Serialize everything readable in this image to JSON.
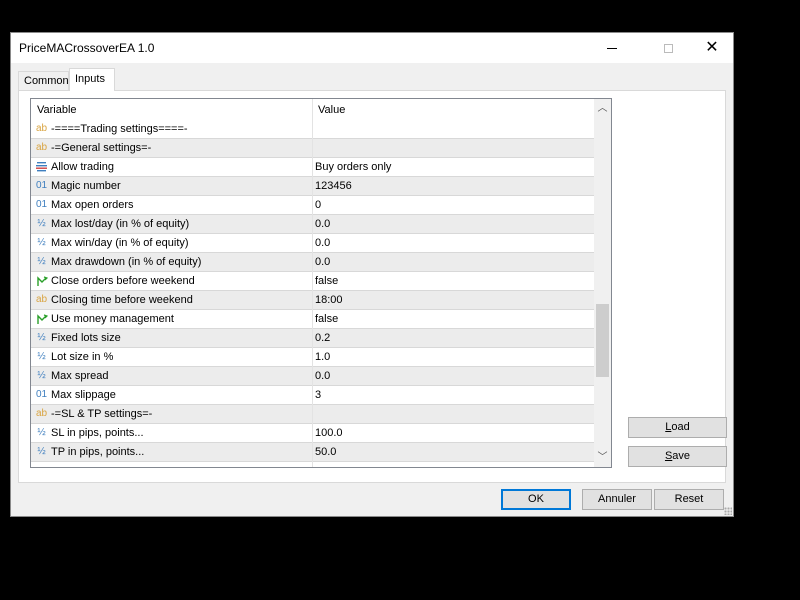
{
  "window": {
    "title": "PriceMACrossoverEA 1.0",
    "controls": {
      "minimize": "minimize-icon",
      "maximize": "maximize-icon",
      "close": "close-icon"
    }
  },
  "tabs": [
    {
      "label": "Common",
      "active": false
    },
    {
      "label": "Inputs",
      "active": true
    }
  ],
  "grid": {
    "columns": {
      "variable": "Variable",
      "value": "Value"
    },
    "rows": [
      {
        "icon": "string-icon",
        "name": "-====Trading settings====-",
        "value": ""
      },
      {
        "icon": "string-icon",
        "name": "-=General settings=-",
        "value": ""
      },
      {
        "icon": "enum-icon",
        "name": "Allow trading",
        "value": "Buy orders only"
      },
      {
        "icon": "integer-icon",
        "name": "Magic number",
        "value": "123456"
      },
      {
        "icon": "integer-icon",
        "name": "Max open orders",
        "value": "0"
      },
      {
        "icon": "double-icon",
        "name": "Max lost/day (in % of equity)",
        "value": "0.0"
      },
      {
        "icon": "double-icon",
        "name": "Max win/day (in % of equity)",
        "value": "0.0"
      },
      {
        "icon": "double-icon",
        "name": "Max drawdown (in % of equity)",
        "value": "0.0"
      },
      {
        "icon": "bool-icon",
        "name": "Close orders before weekend",
        "value": "false"
      },
      {
        "icon": "string-icon",
        "name": "Closing time before weekend",
        "value": "18:00"
      },
      {
        "icon": "bool-icon",
        "name": "Use money management",
        "value": "false"
      },
      {
        "icon": "double-icon",
        "name": "Fixed lots size",
        "value": "0.2"
      },
      {
        "icon": "double-icon",
        "name": "Lot size in %",
        "value": "1.0"
      },
      {
        "icon": "double-icon",
        "name": "Max spread",
        "value": "0.0"
      },
      {
        "icon": "integer-icon",
        "name": "Max slippage",
        "value": "3"
      },
      {
        "icon": "string-icon",
        "name": "-=SL & TP settings=-",
        "value": ""
      },
      {
        "icon": "double-icon",
        "name": "SL in pips, points...",
        "value": "100.0"
      },
      {
        "icon": "double-icon",
        "name": "TP in pips, points...",
        "value": "50.0"
      }
    ],
    "icon_glyphs": {
      "string-icon": "ab",
      "integer-icon": "01",
      "double-icon": "½",
      "bool-icon": "↱",
      "enum-icon": "☰"
    }
  },
  "buttons": {
    "load": {
      "label_first": "L",
      "label_rest": "oad"
    },
    "save": {
      "label_first": "S",
      "label_rest": "ave"
    },
    "ok": "OK",
    "cancel": "Annuler",
    "reset": "Reset"
  },
  "colors": {
    "accent": "#0078d7",
    "string_icon": "#d9a441",
    "numeric_icon": "#3f7fbf",
    "bool_icon": "#2aa02a"
  }
}
